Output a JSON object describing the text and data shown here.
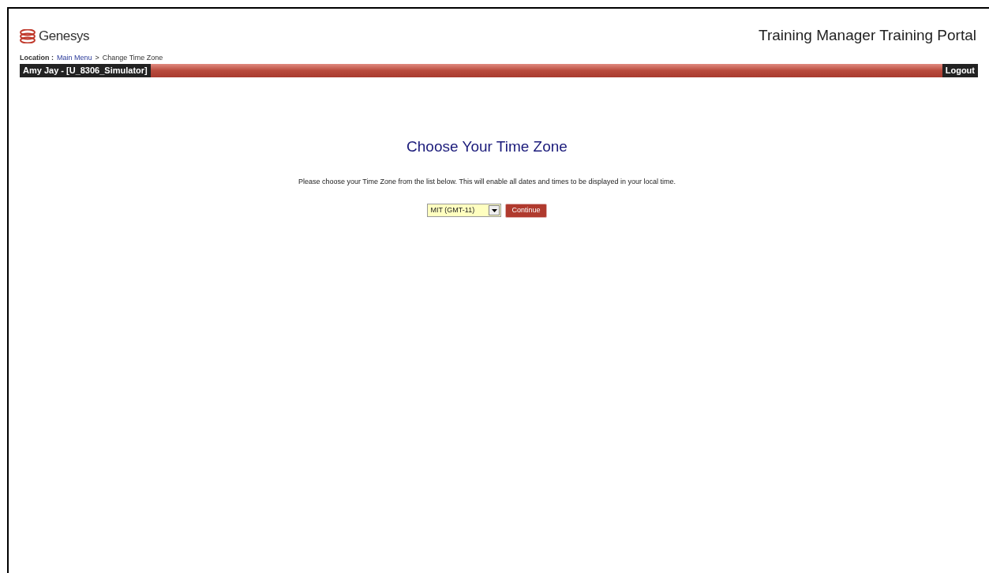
{
  "header": {
    "brand": "Genesys",
    "portal_title": "Training Manager Training Portal"
  },
  "breadcrumb": {
    "label": "Location :",
    "links": [
      "Main Menu"
    ],
    "separator": ">",
    "current": "Change Time Zone"
  },
  "user_bar": {
    "user": "Amy Jay - [U_8306_Simulator]",
    "logout": "Logout"
  },
  "content": {
    "title": "Choose Your Time Zone",
    "instructions": "Please choose your Time Zone from the list below. This will enable all dates and times to be displayed in your local time.",
    "timezone_select": {
      "value": "MIT (GMT-11)"
    },
    "continue_button": "Continue"
  }
}
